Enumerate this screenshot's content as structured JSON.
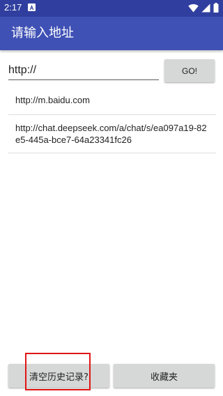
{
  "status_bar": {
    "time": "2:17",
    "icons": [
      "notification-a-icon",
      "wifi-icon",
      "signal-icon",
      "battery-icon"
    ]
  },
  "app_bar": {
    "title": "请输入地址",
    "color": "#3f51b5",
    "status_color": "#303f9f"
  },
  "url_bar": {
    "value": "http://",
    "go_label": "GO!"
  },
  "history": [
    "http://m.baidu.com",
    "http://chat.deepseek.com/a/chat/s/ea097a19-82e5-445a-bce7-64a23341fc26"
  ],
  "bottom": {
    "clear_label": "清空历史记录?",
    "favorites_label": "收藏夹"
  },
  "highlight_color": "#e01515"
}
